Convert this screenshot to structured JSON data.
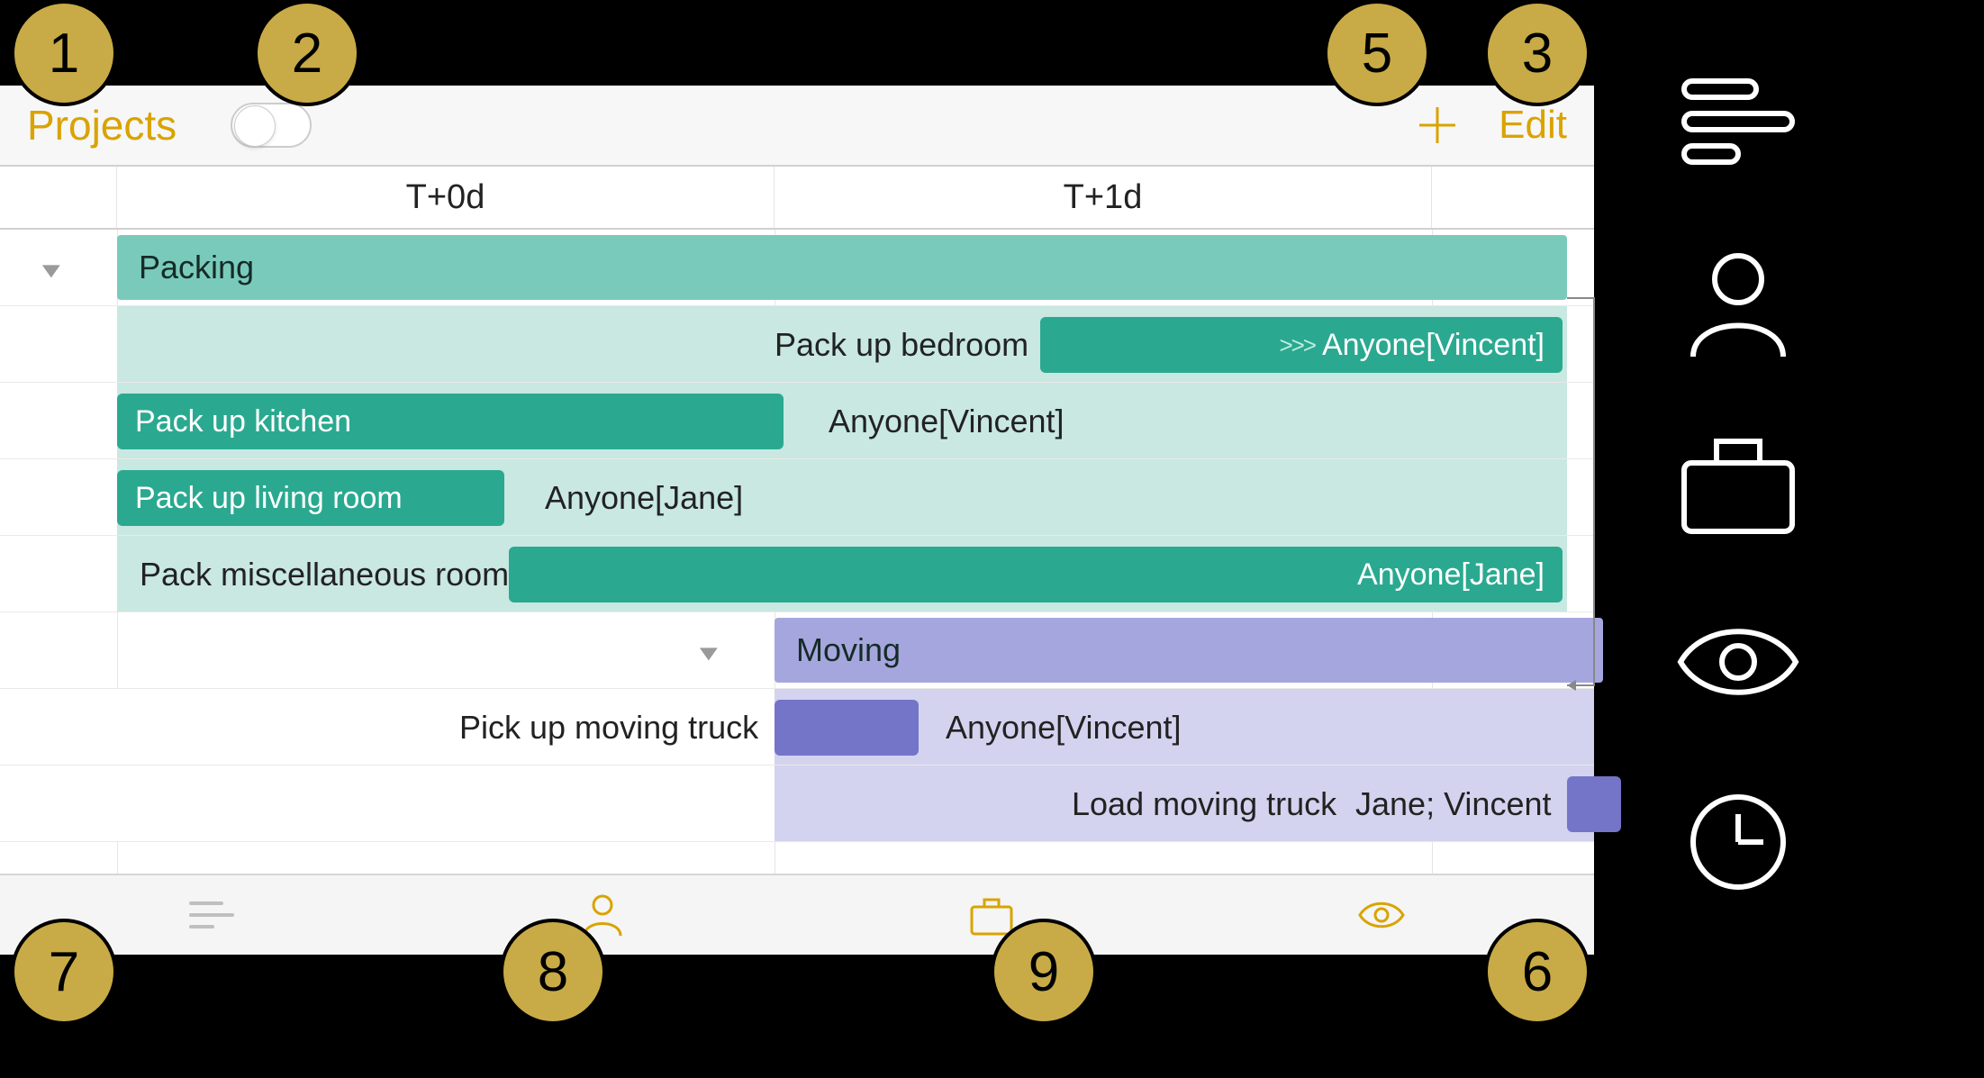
{
  "nav": {
    "title": "Projects",
    "edit": "Edit"
  },
  "timeline": {
    "col0": "T+0d",
    "col1": "T+1d"
  },
  "groups": {
    "packing": "Packing",
    "moving": "Moving"
  },
  "tasks": {
    "pack_bedroom": "Pack up bedroom",
    "pack_bedroom_res": "Anyone[Vincent]",
    "pack_kitchen": "Pack up kitchen",
    "pack_kitchen_res": "Anyone[Vincent]",
    "pack_living": "Pack up living room",
    "pack_living_res": "Anyone[Jane]",
    "pack_misc": "Pack miscellaneous rooms",
    "pack_misc_res": "Anyone[Jane]",
    "pick_truck": "Pick up moving truck",
    "pick_truck_res": "Anyone[Vincent]",
    "load_truck": "Load moving truck",
    "load_truck_res": "Jane; Vincent"
  },
  "badges": {
    "b1": "1",
    "b2": "2",
    "b3": "3",
    "b5": "5",
    "b6": "6",
    "b7": "7",
    "b8": "8",
    "b9": "9"
  }
}
